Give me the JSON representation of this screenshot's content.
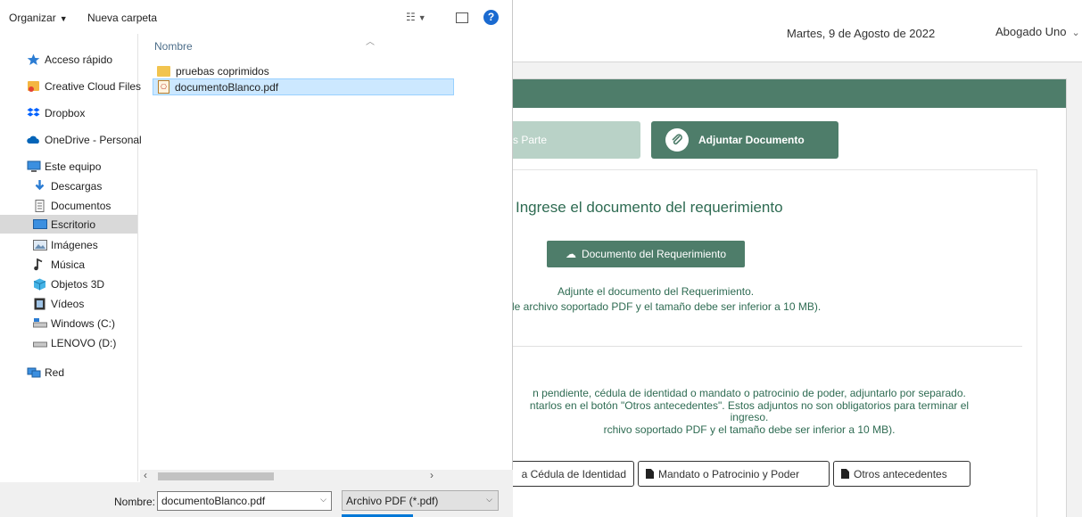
{
  "page": {
    "date": "Martes, 9 de Agosto de 2022",
    "user": "Abogado Uno",
    "tab_datos": "tos Parte",
    "tab_adjuntar": "Adjuntar Documento",
    "section_title": "Ingrese el documento del requerimiento",
    "doc_button": "Documento del Requerimiento",
    "hint1": "Adjunte el documento del Requerimiento.",
    "hint2": "de archivo soportado PDF y el tamaño debe ser inferior a 10 MB).",
    "para_lines": [
      "n pendiente, cédula de identidad o mandato o patrocinio de poder, adjuntarlo por separado.",
      "ntarlos en el botón \"Otros antecedentes\". Estos adjuntos no son obligatorios para terminar el",
      "ingreso.",
      "rchivo soportado PDF y el tamaño debe ser inferior a 10 MB)."
    ],
    "btn_cedula": "a Cédula de Identidad",
    "btn_mandato": "Mandato o Patrocinio y Poder",
    "btn_otros": "Otros antecedentes",
    "colors": {
      "primary_green": "#4e7d6a",
      "light_green": "#b9d2c7",
      "text_green": "#2e6b52"
    }
  },
  "dialog": {
    "toolbar": {
      "organize": "Organizar",
      "new_folder": "Nueva carpeta"
    },
    "nav": [
      {
        "label": "Acceso rápido",
        "icon": "star-icon"
      },
      {
        "label": "Creative Cloud Files",
        "icon": "creative-cloud-icon"
      },
      {
        "label": "Dropbox",
        "icon": "dropbox-icon"
      },
      {
        "label": "OneDrive - Personal",
        "icon": "onedrive-icon"
      },
      {
        "label": "Este equipo",
        "icon": "computer-icon"
      },
      {
        "label": "Descargas",
        "icon": "download-icon"
      },
      {
        "label": "Documentos",
        "icon": "documents-icon"
      },
      {
        "label": "Escritorio",
        "icon": "desktop-icon",
        "selected": true
      },
      {
        "label": "Imágenes",
        "icon": "pictures-icon"
      },
      {
        "label": "Música",
        "icon": "music-icon"
      },
      {
        "label": "Objetos 3D",
        "icon": "objects3d-icon"
      },
      {
        "label": "Vídeos",
        "icon": "videos-icon"
      },
      {
        "label": "Windows (C:)",
        "icon": "drive-c-icon"
      },
      {
        "label": "LENOVO (D:)",
        "icon": "drive-d-icon"
      },
      {
        "label": "Red",
        "icon": "network-icon"
      }
    ],
    "column_header": "Nombre",
    "files": [
      {
        "name": "pruebas coprimidos",
        "type": "folder"
      },
      {
        "name": "documentoBlanco.pdf",
        "type": "pdf",
        "selected": true
      }
    ],
    "footer": {
      "name_label": "Nombre:",
      "name_value": "documentoBlanco.pdf",
      "file_type": "Archivo PDF (*.pdf)"
    }
  }
}
